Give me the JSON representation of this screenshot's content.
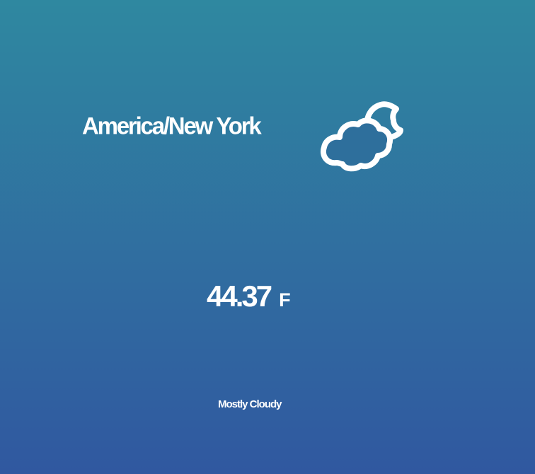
{
  "location": {
    "timezone": "America/New York"
  },
  "weather": {
    "icon": "partly-cloudy-night-icon",
    "temperature": "44.37",
    "unit": "F",
    "summary": "Mostly Cloudy"
  },
  "colors": {
    "background_top": "#2f88a0",
    "background_bottom": "#3058a0",
    "text": "#ffffff"
  }
}
